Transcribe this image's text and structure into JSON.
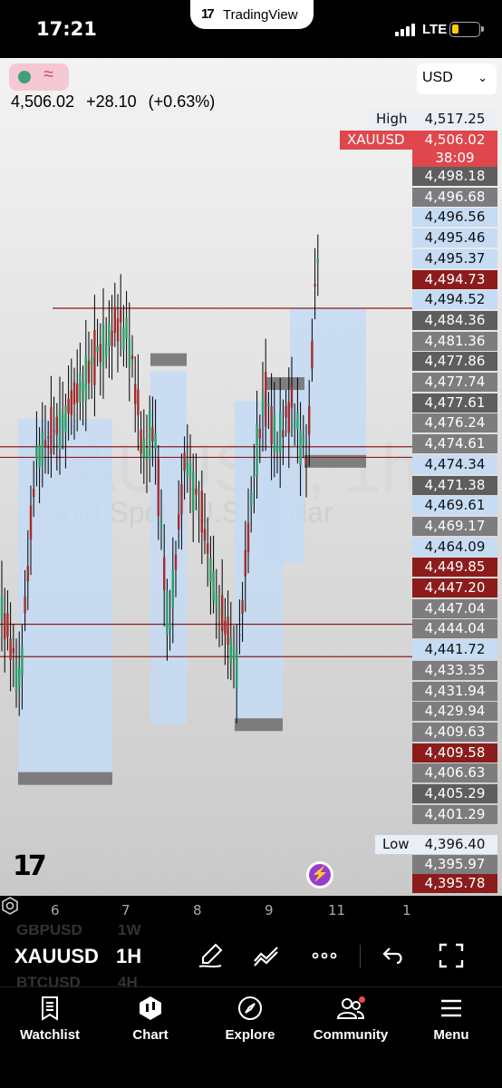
{
  "status_bar": {
    "time": "17:21",
    "app_name": "TradingView",
    "network": "LTE"
  },
  "chart": {
    "symbol": "XAUUSD",
    "watermark_symbol": "XAUUSD, 1h",
    "watermark_name": "Gold Spot / U.S. Dollar",
    "price": "4,506.02",
    "change": "+28.10",
    "change_pct": "(+0.63%)",
    "currency": "USD",
    "high_label": "High",
    "high_value": "4,517.25",
    "low_label": "Low",
    "low_value": "4,396.40",
    "countdown": "38:09",
    "price_labels": [
      {
        "value": "4,498.18",
        "style": "dark"
      },
      {
        "value": "4,496.68",
        "style": "mid"
      },
      {
        "value": "4,496.56",
        "style": "light"
      },
      {
        "value": "4,495.46",
        "style": "light"
      },
      {
        "value": "4,495.37",
        "style": "light"
      },
      {
        "value": "4,494.73",
        "style": "red"
      },
      {
        "value": "4,494.52",
        "style": "light"
      },
      {
        "value": "4,484.36",
        "style": "dark"
      },
      {
        "value": "4,481.36",
        "style": "mid"
      },
      {
        "value": "4,477.86",
        "style": "dark"
      },
      {
        "value": "4,477.74",
        "style": "mid"
      },
      {
        "value": "4,477.61",
        "style": "dark"
      },
      {
        "value": "4,476.24",
        "style": "mid"
      },
      {
        "value": "4,474.61",
        "style": "mid"
      },
      {
        "value": "4,474.34",
        "style": "light"
      },
      {
        "value": "4,471.38",
        "style": "dark"
      },
      {
        "value": "4,469.61",
        "style": "light"
      },
      {
        "value": "4,469.17",
        "style": "mid"
      },
      {
        "value": "4,464.09",
        "style": "light"
      },
      {
        "value": "4,449.85",
        "style": "red"
      },
      {
        "value": "4,447.20",
        "style": "red"
      },
      {
        "value": "4,447.04",
        "style": "mid"
      },
      {
        "value": "4,444.04",
        "style": "mid"
      },
      {
        "value": "4,441.72",
        "style": "light"
      },
      {
        "value": "4,433.35",
        "style": "mid"
      },
      {
        "value": "4,431.94",
        "style": "mid"
      },
      {
        "value": "4,429.94",
        "style": "mid"
      },
      {
        "value": "4,409.63",
        "style": "mid"
      },
      {
        "value": "4,409.58",
        "style": "red"
      },
      {
        "value": "4,406.63",
        "style": "mid"
      },
      {
        "value": "4,405.29",
        "style": "dark"
      },
      {
        "value": "4,401.29",
        "style": "mid"
      },
      {
        "value": "4,395.97",
        "style": "mid"
      },
      {
        "value": "4,395.78",
        "style": "red"
      }
    ],
    "x_ticks": [
      "6",
      "7",
      "8",
      "9",
      "11",
      "1"
    ]
  },
  "toolbar": {
    "symbol": "XAUUSD",
    "timeframe": "1H",
    "ghost_symbol_top": "GBPUSD",
    "ghost_tf_top": "1W",
    "ghost_symbol_bottom": "BTCUSD",
    "ghost_tf_bottom": "4H"
  },
  "nav": {
    "items": [
      {
        "label": "Watchlist",
        "icon": "watchlist-icon"
      },
      {
        "label": "Chart",
        "icon": "chart-icon"
      },
      {
        "label": "Explore",
        "icon": "compass-icon"
      },
      {
        "label": "Community",
        "icon": "community-icon"
      },
      {
        "label": "Menu",
        "icon": "menu-icon"
      }
    ]
  },
  "colors": {
    "up_candle": "#2e9d6a",
    "down_candle": "#a52c2c",
    "zone_fill": "#c4daf5",
    "level_line": "#8b1f1f",
    "accent_red": "#e0474c"
  }
}
